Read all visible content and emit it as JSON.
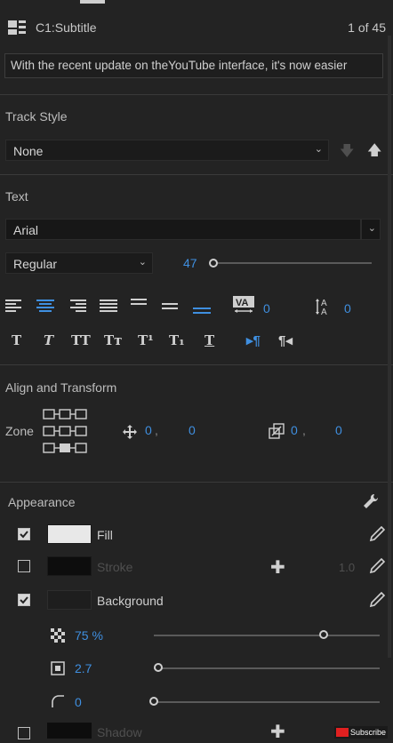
{
  "header": {
    "title": "C1:Subtitle",
    "counter": "1 of 45",
    "caption_text": "With the recent update on theYouTube interface, it's now easier"
  },
  "track_style": {
    "label": "Track Style",
    "value": "None"
  },
  "text": {
    "label": "Text",
    "font": "Arial",
    "style": "Regular",
    "size": "47",
    "size_level": 0.0,
    "tracking": "0",
    "leading": "0"
  },
  "format_buttons": [
    "T",
    "T",
    "TT",
    "Tт",
    "T¹",
    "T₁",
    "T"
  ],
  "direction_buttons": [
    "▸¶",
    "¶◂"
  ],
  "align_transform": {
    "label": "Align and Transform",
    "zone_label": "Zone",
    "position_x": "0",
    "position_y": "0",
    "scale_x": "0",
    "scale_y": "0",
    "separator": ","
  },
  "appearance": {
    "label": "Appearance",
    "fill": {
      "label": "Fill",
      "checked": true,
      "color": "#e8e8e8"
    },
    "stroke": {
      "label": "Stroke",
      "checked": false,
      "color": "#0d0d0d",
      "width": "1.0"
    },
    "background": {
      "label": "Background",
      "checked": true,
      "color": "#1e1e1e"
    },
    "opacity": {
      "value": "75 %",
      "level": 0.75
    },
    "size": {
      "value": "2.7",
      "level": 0.02
    },
    "corner": {
      "value": "0",
      "level": 0.0
    },
    "shadow": {
      "label": "Shadow"
    }
  },
  "watermark": {
    "label": "Subscribe"
  }
}
